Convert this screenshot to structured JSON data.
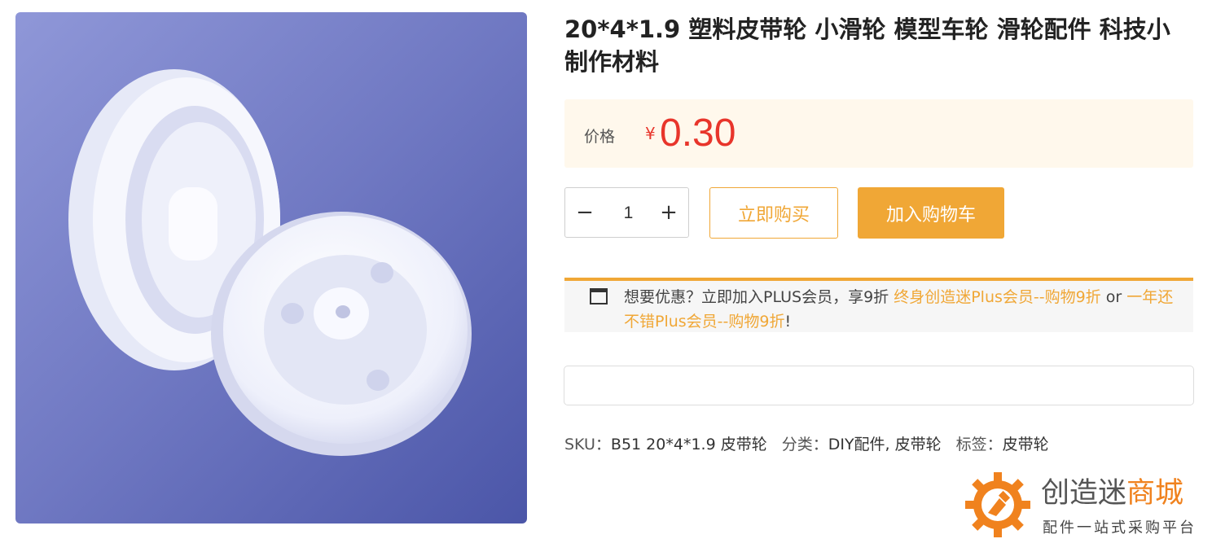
{
  "product": {
    "title": "20*4*1.9 塑料皮带轮 小滑轮 模型车轮 滑轮配件 科技小制作材料",
    "image_alt": "白色塑料皮带轮"
  },
  "price": {
    "label": "价格",
    "currency": "¥",
    "value": "0.30"
  },
  "quantity": {
    "minus": "−",
    "value": "1",
    "plus": "+"
  },
  "actions": {
    "buy_now": "立即购买",
    "add_to_cart": "加入购物车"
  },
  "promo": {
    "text": "想要优惠？立即加入PLUS会员，享9折 ",
    "link1": "终身创造迷Plus会员--购物9折",
    "or": " or ",
    "link2": "一年还不错Plus会员--购物9折",
    "end": "!"
  },
  "meta": {
    "sku_label": "SKU：",
    "sku_value": "B51 20*4*1.9 皮带轮",
    "category_label": "分类：",
    "category_value": "DIY配件, 皮带轮",
    "tag_label": "标签：",
    "tag_value": "皮带轮"
  },
  "brand": {
    "name_part1": "创造迷",
    "name_part2": "商城",
    "slogan": "配件一站式采购平台"
  },
  "colors": {
    "accent": "#f0a736",
    "price": "#e8352b",
    "brand_orange": "#f0821e"
  }
}
